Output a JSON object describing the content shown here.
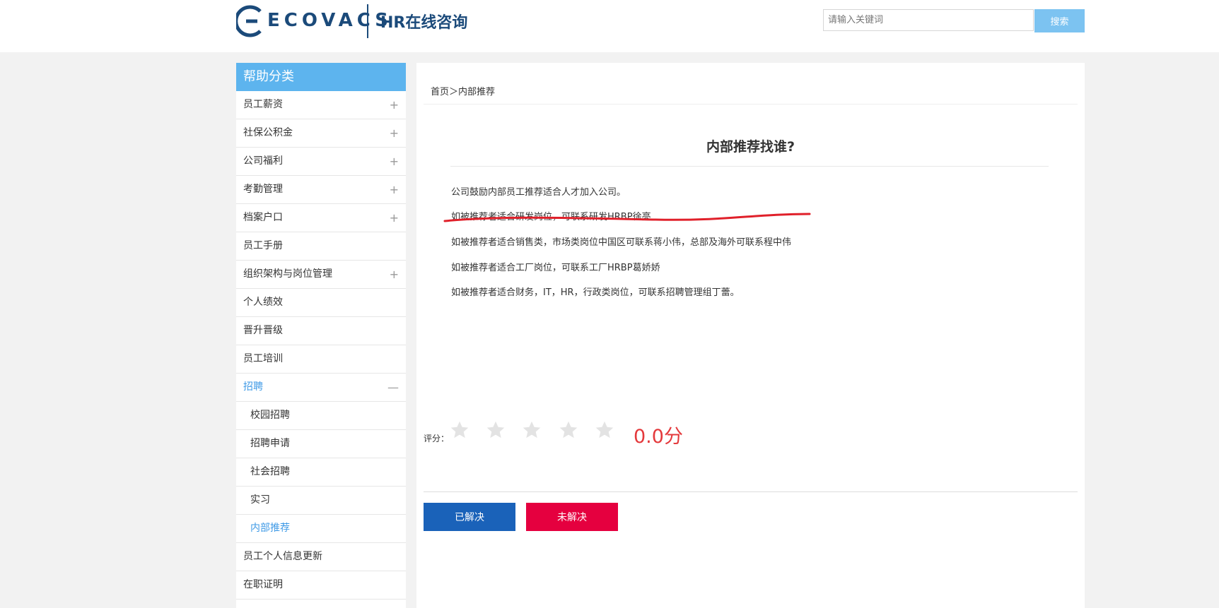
{
  "header": {
    "logo_text": "ECOVACS",
    "title": "HR在线咨询",
    "search_placeholder": "请输入关键词",
    "search_button": "搜索"
  },
  "sidebar": {
    "title": "帮助分类",
    "items": [
      {
        "label": "员工薪资",
        "toggle": "+"
      },
      {
        "label": "社保公积金",
        "toggle": "+"
      },
      {
        "label": "公司福利",
        "toggle": "+"
      },
      {
        "label": "考勤管理",
        "toggle": "+"
      },
      {
        "label": "档案户口",
        "toggle": "+"
      },
      {
        "label": "员工手册",
        "toggle": ""
      },
      {
        "label": "组织架构与岗位管理",
        "toggle": "+"
      },
      {
        "label": "个人绩效",
        "toggle": ""
      },
      {
        "label": "晋升晋级",
        "toggle": ""
      },
      {
        "label": "员工培训",
        "toggle": ""
      },
      {
        "label": "招聘",
        "toggle": "—"
      },
      {
        "label": "校园招聘",
        "toggle": ""
      },
      {
        "label": "招聘申请",
        "toggle": ""
      },
      {
        "label": "社会招聘",
        "toggle": ""
      },
      {
        "label": "实习",
        "toggle": ""
      },
      {
        "label": "内部推荐",
        "toggle": ""
      },
      {
        "label": "员工个人信息更新",
        "toggle": ""
      },
      {
        "label": "在职证明",
        "toggle": ""
      }
    ]
  },
  "main": {
    "breadcrumb": "首页＞内部推荐",
    "title": "内部推荐找谁?",
    "paragraphs": [
      "公司鼓励内部员工推荐适合人才加入公司。",
      "如被推荐者适合研发岗位，可联系研发HRBP徐亮",
      "如被推荐者适合销售类，市场类岗位中国区可联系蒋小伟，总部及海外可联系程中伟",
      "如被推荐者适合工厂岗位，可联系工厂HRBP葛娇娇",
      "如被推荐者适合财务，IT，HR，行政类岗位，可联系招聘管理组丁蕾。"
    ],
    "rating_label": "评分：",
    "rating_value": 0,
    "rating_max": 5,
    "score_text": "0.0分",
    "solved_button": "已解决",
    "unsolved_button": "未解决"
  },
  "colors": {
    "accent": "#5db4ee",
    "active_nav": "#3f9ae6",
    "score": "#e4393c",
    "solved": "#1a62b9",
    "unsolved": "#e5003f",
    "annotation": "#e0202a"
  }
}
